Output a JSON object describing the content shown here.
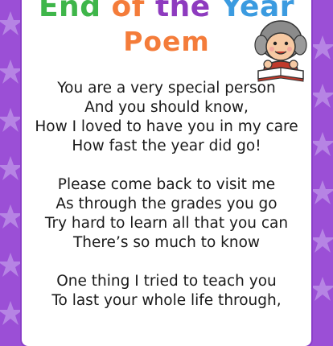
{
  "title": {
    "line1_words": [
      "End",
      "of",
      "the",
      "Year"
    ],
    "line2": "Poem"
  },
  "poem": {
    "stanzas": [
      [
        "You are a very special person",
        "And you should know,",
        "How I loved to have you in my care",
        "How fast the year did go!"
      ],
      [
        "Please come back to visit me",
        "As through the grades you go",
        "Try hard to learn all that you can",
        "There’s so much to know"
      ],
      [
        "One thing I tried to teach you",
        "To last your whole life through,"
      ]
    ]
  },
  "colors": {
    "border": "#9b4fd6",
    "end": "#3fb64a",
    "of": "#f47c3a",
    "the": "#8e3bbf",
    "year": "#3b9be0",
    "poem": "#f47c3a"
  },
  "illustration": "reading-child-icon"
}
